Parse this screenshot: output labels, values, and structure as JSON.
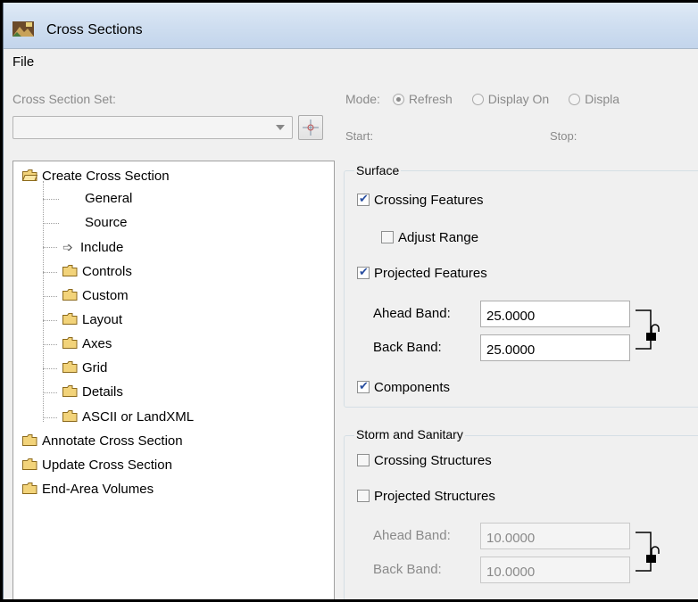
{
  "window": {
    "title": "Cross Sections"
  },
  "menu": {
    "file": "File"
  },
  "cross_section_set": {
    "label": "Cross Section Set:",
    "value": ""
  },
  "mode": {
    "label": "Mode:",
    "options": [
      "Refresh",
      "Display On",
      "Displa"
    ],
    "selected": "Refresh"
  },
  "range": {
    "start_label": "Start:",
    "stop_label": "Stop:"
  },
  "tree": {
    "root": "Create Cross Section",
    "children": [
      "General",
      "Source",
      "Include",
      "Controls",
      "Custom",
      "Layout",
      "Axes",
      "Grid",
      "Details",
      "ASCII or LandXML"
    ],
    "selected": "Include",
    "others": [
      "Annotate Cross Section",
      "Update Cross Section",
      "End-Area Volumes"
    ]
  },
  "surface": {
    "title": "Surface",
    "crossing_features": {
      "label": "Crossing Features",
      "checked": true
    },
    "adjust_range": {
      "label": "Adjust Range",
      "checked": false
    },
    "projected_features": {
      "label": "Projected Features",
      "checked": true
    },
    "ahead_band": {
      "label": "Ahead Band:",
      "value": "25.0000"
    },
    "back_band": {
      "label": "Back Band:",
      "value": "25.0000"
    },
    "components": {
      "label": "Components",
      "checked": true
    }
  },
  "storm": {
    "title": "Storm and Sanitary",
    "crossing_structures": {
      "label": "Crossing Structures",
      "checked": false
    },
    "projected_structures": {
      "label": "Projected Structures",
      "checked": false
    },
    "ahead_band": {
      "label": "Ahead Band:",
      "value": "10.0000"
    },
    "back_band": {
      "label": "Back Band:",
      "value": "10.0000"
    }
  }
}
